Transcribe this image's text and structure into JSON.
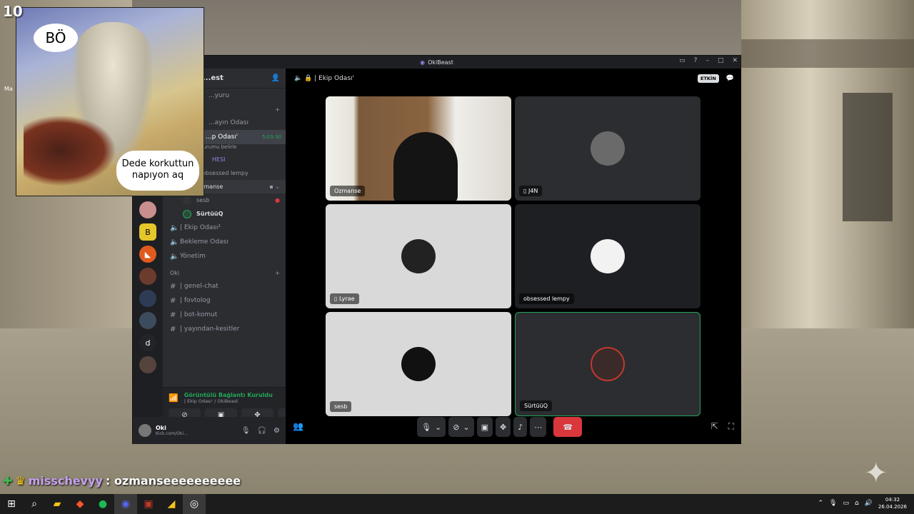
{
  "overlay": {
    "counter": "10",
    "meme_top": "BÖ",
    "meme_bottom": "Dede korkuttun napıyon aq"
  },
  "desktop": {
    "icon_label": "Ma"
  },
  "window": {
    "title": "OkiBeast"
  },
  "server": {
    "name": "...est"
  },
  "sidebar": {
    "items": [
      {
        "icon": "volume-icon",
        "label": "...yuru",
        "type": "channel"
      },
      {
        "icon": "volume-icon",
        "label": "...ayın Odası",
        "type": "channel"
      },
      {
        "icon": "volume-icon",
        "label": "...p Odası'",
        "type": "channel-active",
        "timer": "5:03:30",
        "status": "durumu belirle"
      },
      {
        "label": "HESI",
        "type": "member"
      },
      {
        "label": "obsessed lempy",
        "type": "member"
      },
      {
        "label": "Ozmanse",
        "type": "member-hover"
      },
      {
        "label": "sesb",
        "type": "member"
      },
      {
        "label": "SürtüüQ",
        "type": "member"
      },
      {
        "icon": "volume-icon",
        "label": "| Ekip Odası²",
        "type": "channel"
      },
      {
        "icon": "volume-icon",
        "label": "Bekleme Odası",
        "type": "channel"
      },
      {
        "icon": "volume-icon",
        "label": "Yönetim",
        "type": "channel"
      }
    ],
    "category": "Oki",
    "text_channels": [
      "| genel-chat",
      "| fovtolog",
      "| bot-komut",
      "| yayından-kesitler"
    ]
  },
  "voice_panel": {
    "status": "Görüntülü Bağlantı Kuruldu",
    "channel": "| Ekip Odası' / OkiBeast"
  },
  "user": {
    "name": "Oki",
    "status": "Kick.com/Oki..."
  },
  "stage": {
    "channel_title": "| Ekip Odası'",
    "activity_badge": "ETKİN",
    "tiles": [
      {
        "name": "Ozmanse",
        "kind": "camera"
      },
      {
        "name": "J4N",
        "kind": "mobile"
      },
      {
        "name": "Lyrae",
        "kind": "mobile"
      },
      {
        "name": "obsessed lempy",
        "kind": "avatar"
      },
      {
        "name": "sesb",
        "kind": "avatar"
      },
      {
        "name": "SürtüüQ",
        "kind": "speaking"
      }
    ]
  },
  "chat_overlay": {
    "user": "misschevyy",
    "message": ": ozmanseeeeeeeeee"
  },
  "taskbar": {
    "time": "04:32",
    "date": "26.04.2026"
  },
  "colors": {
    "accent_green": "#23a559",
    "hangup_red": "#da373c",
    "bg_dark": "#1e1f22",
    "brand": "#5865f2"
  }
}
